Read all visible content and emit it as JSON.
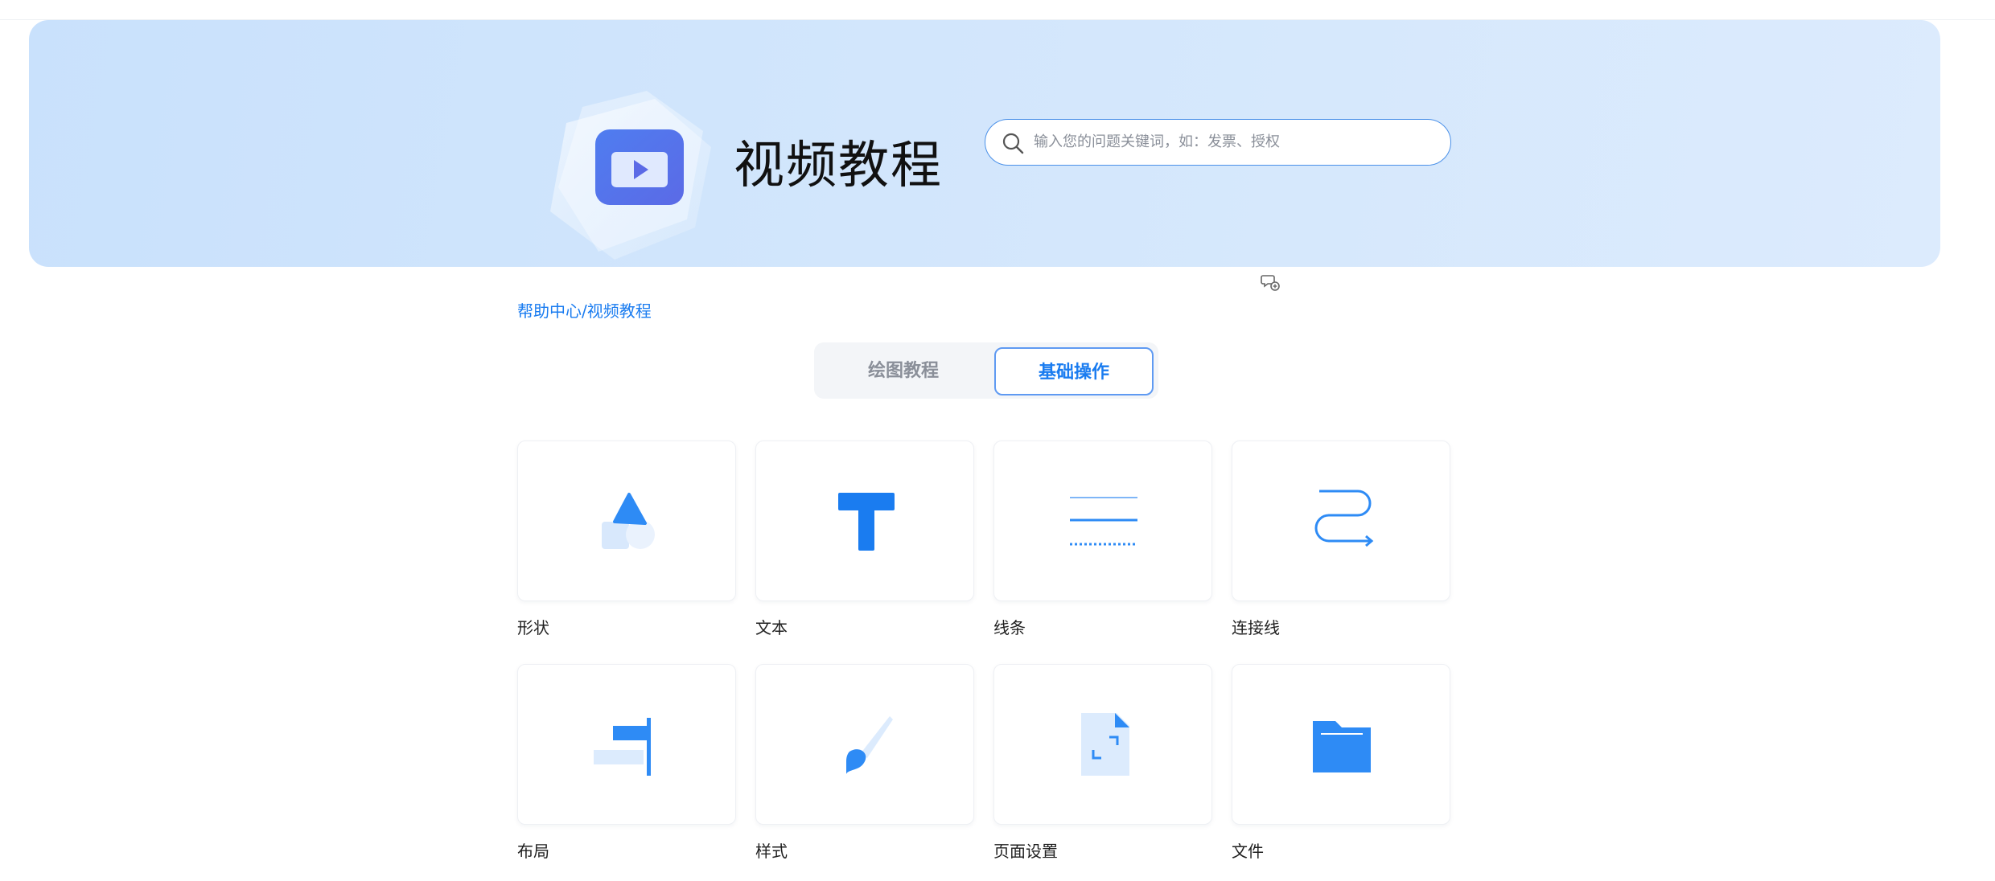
{
  "hero": {
    "title": "视频教程",
    "search_placeholder": "输入您的问题关键词，如：发票、授权"
  },
  "breadcrumb": {
    "home": "帮助中心",
    "separator": "/",
    "current": "视频教程"
  },
  "tabs": [
    {
      "label": "绘图教程",
      "active": false
    },
    {
      "label": "基础操作",
      "active": true
    }
  ],
  "cards": [
    {
      "label": "形状",
      "icon": "shapes-icon"
    },
    {
      "label": "文本",
      "icon": "text-icon"
    },
    {
      "label": "线条",
      "icon": "lines-icon"
    },
    {
      "label": "连接线",
      "icon": "connector-icon"
    },
    {
      "label": "布局",
      "icon": "layout-icon"
    },
    {
      "label": "样式",
      "icon": "brush-icon"
    },
    {
      "label": "页面设置",
      "icon": "page-settings-icon"
    },
    {
      "label": "文件",
      "icon": "folder-icon"
    }
  ],
  "colors": {
    "accent": "#1a7cf0",
    "icon_blue": "#2e8bf5",
    "hero_bg": "#cfe4fc"
  }
}
